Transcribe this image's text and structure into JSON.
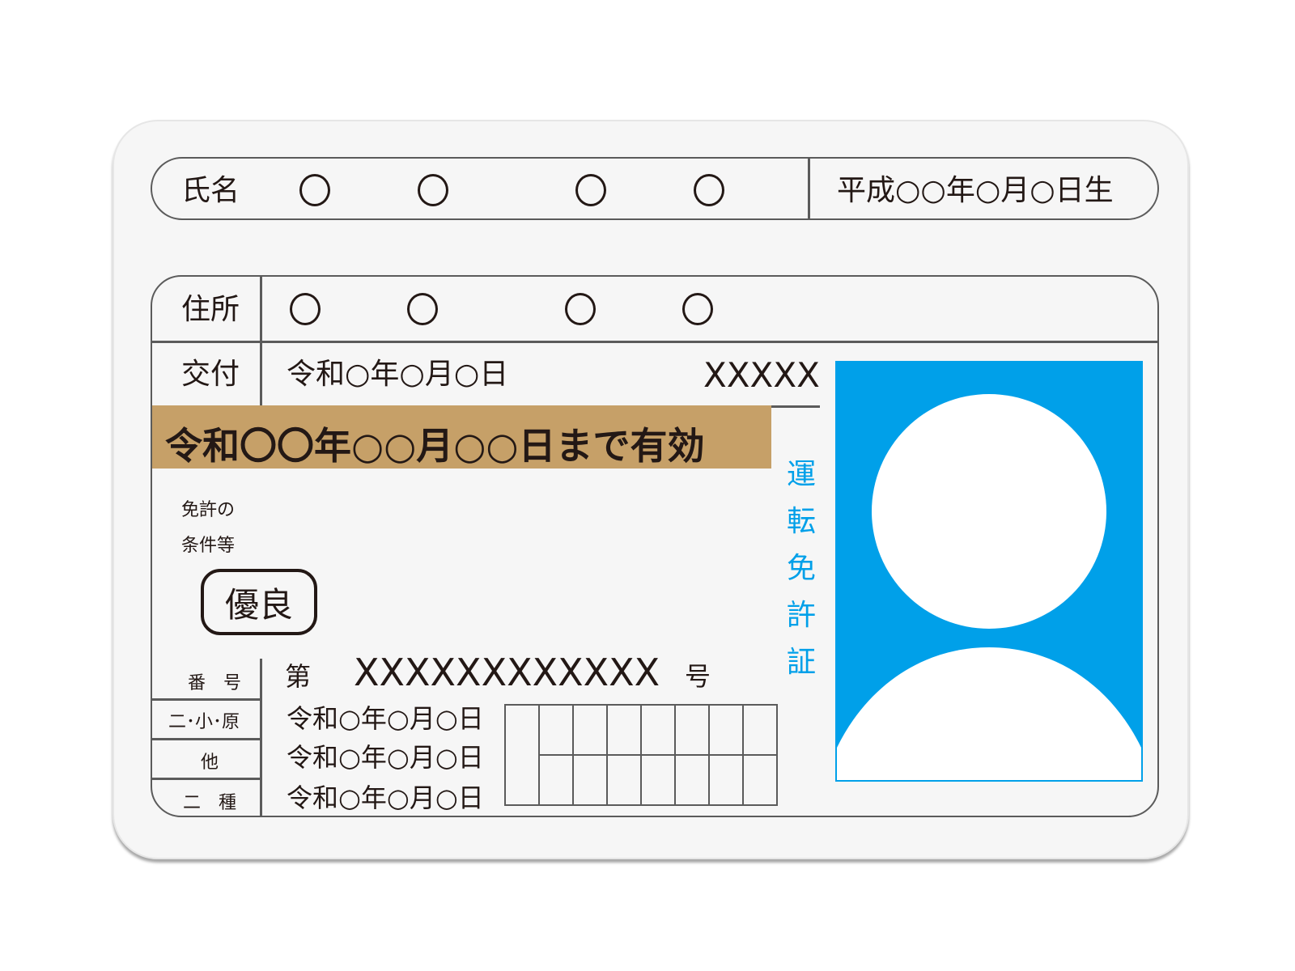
{
  "name_row": {
    "label": "氏名",
    "birth": "平成○○年○月○日生"
  },
  "address_row": {
    "label": "住所"
  },
  "issue_row": {
    "label": "交付",
    "date": "令和○年○月○日",
    "code": "XXXXX"
  },
  "validity": {
    "text": "令和〇〇年○○月○○日まで有効",
    "bar_color": "#c6a068"
  },
  "conditions": {
    "line1": "免許の",
    "line2": "条件等"
  },
  "badge": {
    "text": "優良"
  },
  "vertical_title": [
    "運",
    "転",
    "免",
    "許",
    "証"
  ],
  "license_number": {
    "label": "番　号",
    "prefix": "第",
    "number": "XXXXXXXXXXXX",
    "suffix": "号"
  },
  "categories": [
    {
      "label": "二･小･原",
      "date": "令和○年○月○日"
    },
    {
      "label": "他",
      "date": "令和○年○月○日"
    },
    {
      "label": "二　種",
      "date": "令和○年○月○日"
    }
  ],
  "colors": {
    "accent_blue": "#00a0e9",
    "ink": "#231815",
    "card": "#f6f6f6"
  },
  "icons": {
    "photo": "person-silhouette-icon"
  }
}
